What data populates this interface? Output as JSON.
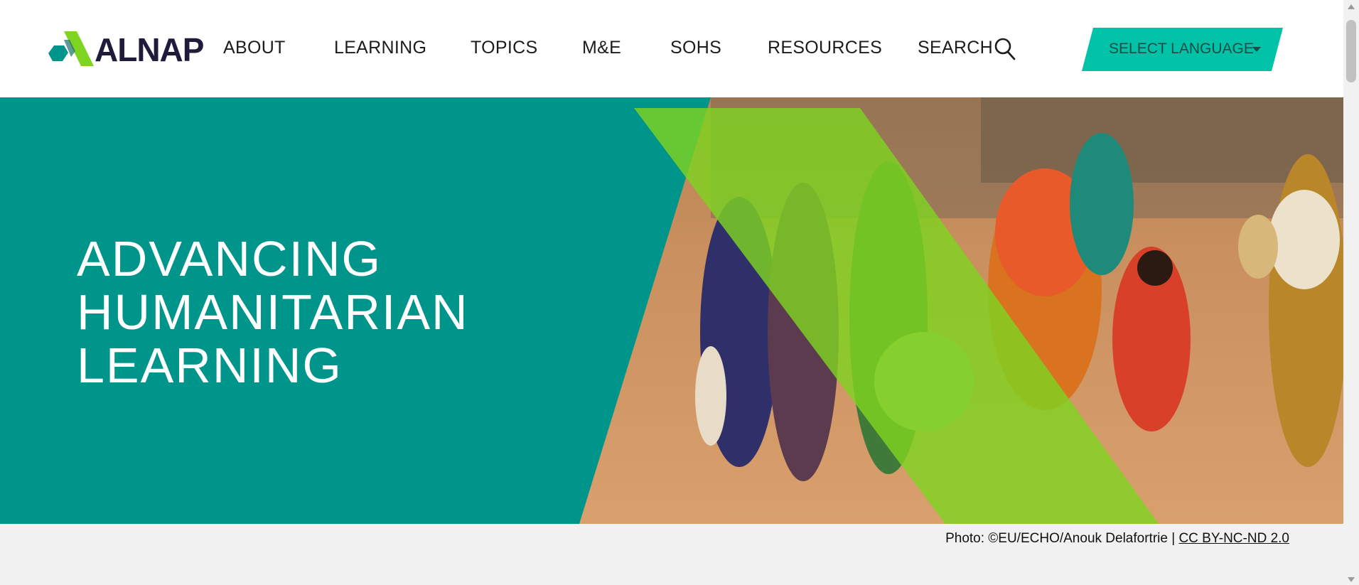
{
  "brand": {
    "name": "ALNAP",
    "teal": "#00958a",
    "lime": "#7fd321",
    "dark": "#1f1b3a",
    "accent": "#00c2a6"
  },
  "nav": {
    "items": [
      {
        "label": "ABOUT"
      },
      {
        "label": "LEARNING"
      },
      {
        "label": "TOPICS"
      },
      {
        "label": "M&E"
      },
      {
        "label": "SOHS"
      },
      {
        "label": "RESOURCES"
      },
      {
        "label": "SEARCH"
      }
    ],
    "search_icon": "search-icon",
    "language_label": "SELECT LANGUAGE",
    "language_icon": "caret-down-icon"
  },
  "hero": {
    "title_lines": [
      "ADVANCING",
      "HUMANITARIAN",
      "LEARNING"
    ],
    "image_description_icon": "hero-photo"
  },
  "credit": {
    "text": "Photo: ©EU/ECHO/Anouk Delafortrie |",
    "license_link": "CC BY-NC-ND 2.0"
  }
}
